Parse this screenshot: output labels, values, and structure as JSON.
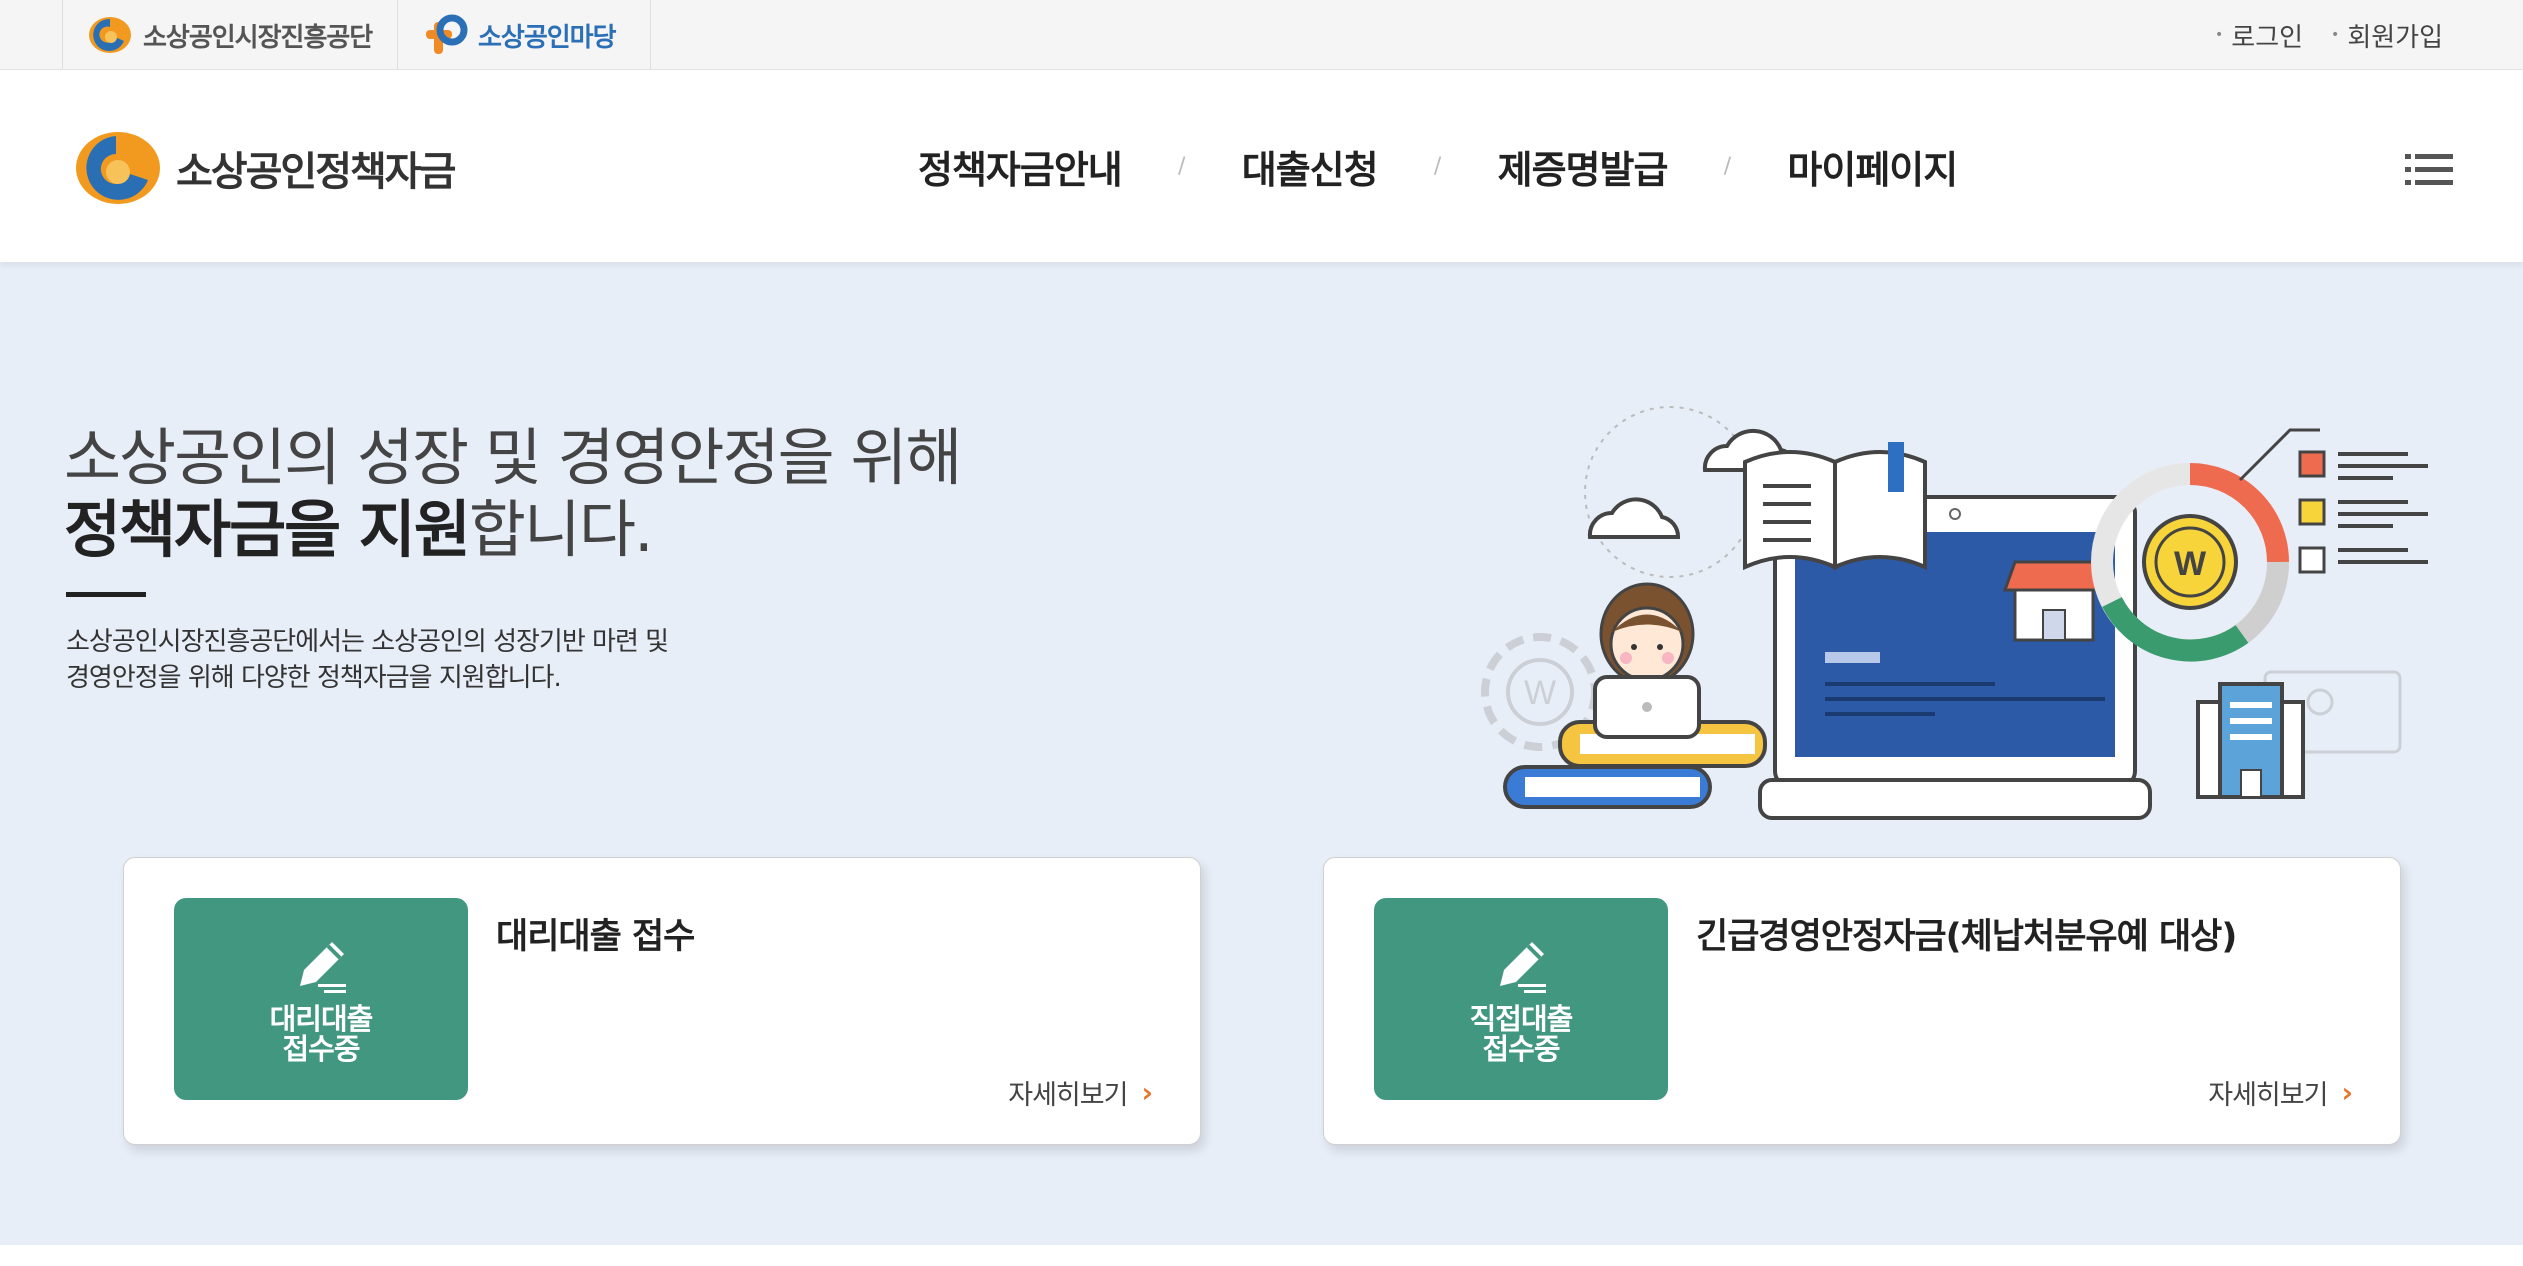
{
  "topbar": {
    "site1": "소상공인시장진흥공단",
    "site2": "소상공인마당",
    "login": "로그인",
    "signup": "회원가입"
  },
  "header": {
    "brand": "소상공인정책자금",
    "nav": [
      "정책자금안내",
      "대출신청",
      "제증명발급",
      "마이페이지"
    ]
  },
  "hero": {
    "headline_line1": "소상공인의 성장 및 경영안정을 위해",
    "headline_bold": "정책자금을 지원",
    "headline_tail": "합니다.",
    "desc_line1": "소상공인시장진흥공단에서는 소상공인의 성장기반 마련 및",
    "desc_line2": "경영안정을 위해 다양한 정책자금을 지원합니다."
  },
  "cards": [
    {
      "badge": "대리대출\n접수중",
      "title": "대리대출 접수",
      "more": "자세히보기"
    },
    {
      "badge": "직접대출\n접수중",
      "title": "긴급경영안정자금(체납처분유예 대상)",
      "more": "자세히보기"
    }
  ],
  "colors": {
    "hero_bg": "#e8eef8",
    "badge_green": "#429781",
    "accent_orange": "#e8752a",
    "site2_blue": "#2b6fb6"
  }
}
